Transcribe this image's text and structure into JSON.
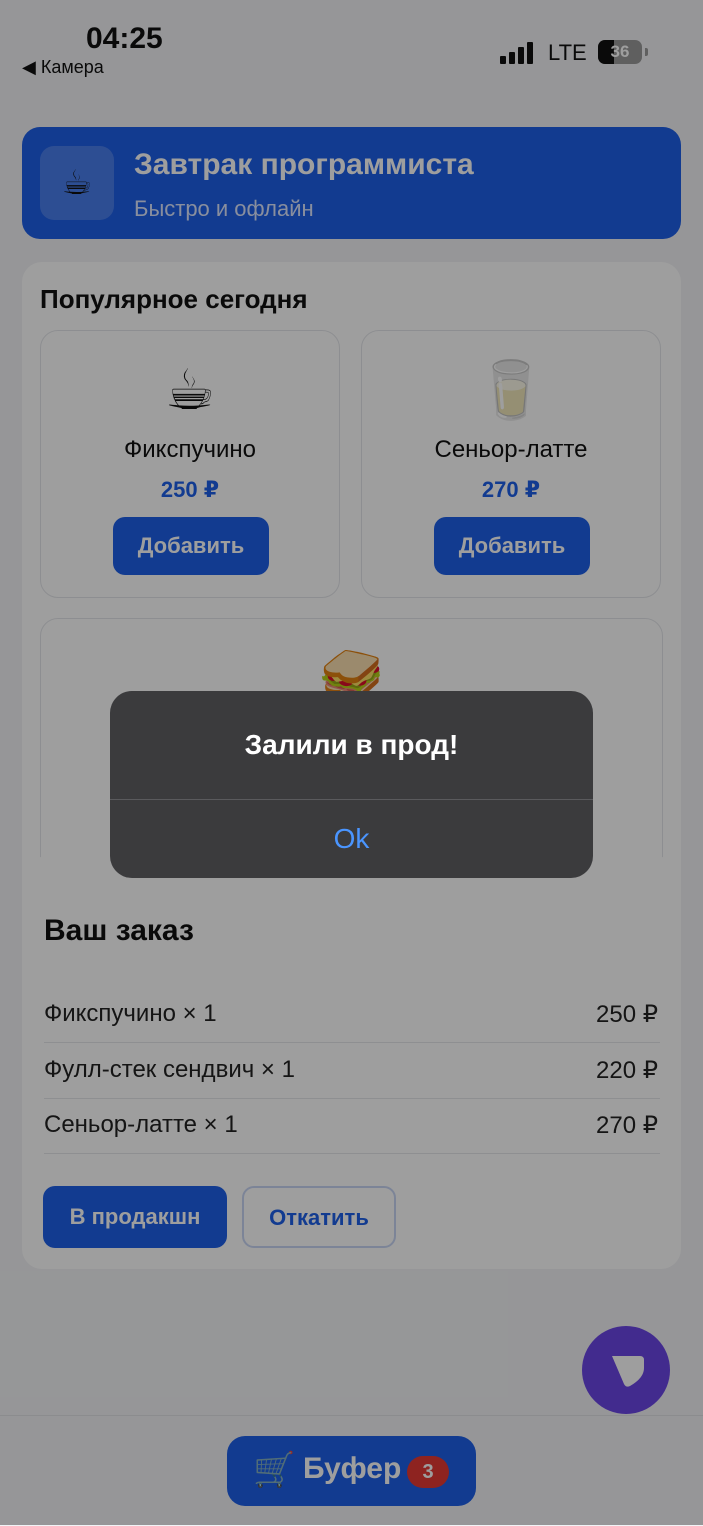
{
  "status_bar": {
    "time": "04:25",
    "back_label": "◀ Камера",
    "network": "LTE",
    "battery": "36",
    "icons": [
      "signal-icon",
      "battery-icon"
    ]
  },
  "header": {
    "title": "Завтрак программиста",
    "subtitle": "Быстро и офлайн",
    "logo_icon": "coffee-cup-icon"
  },
  "popular": {
    "title": "Популярное сегодня",
    "items": [
      {
        "emoji": "☕",
        "name": "Фикспучино",
        "price": "250 ₽",
        "button": "Добавить"
      },
      {
        "emoji": "🥛",
        "name": "Сеньор-латте",
        "price": "270 ₽",
        "button": "Добавить"
      },
      {
        "emoji": "🥪"
      }
    ]
  },
  "order": {
    "title": "Ваш заказ",
    "lines": [
      {
        "item": "Фикспучино × 1",
        "price": "250 ₽"
      },
      {
        "item": "Фулл-стек сендвич × 1",
        "price": "220 ₽"
      },
      {
        "item": "Сеньор-латте × 1",
        "price": "270 ₽"
      }
    ],
    "deploy_label": "В продакшн",
    "rollback_label": "Откатить"
  },
  "cart": {
    "icon": "🛒",
    "label": "Буфер",
    "count": "3"
  },
  "alert": {
    "title": "Залили в прод!",
    "ok_label": "Ok"
  },
  "colors": {
    "accent": "#1d5fe8",
    "fab": "#6b46e6",
    "badge": "#e53935",
    "alert_bg": "#3b3b3d",
    "alert_button": "#4a95ff"
  }
}
